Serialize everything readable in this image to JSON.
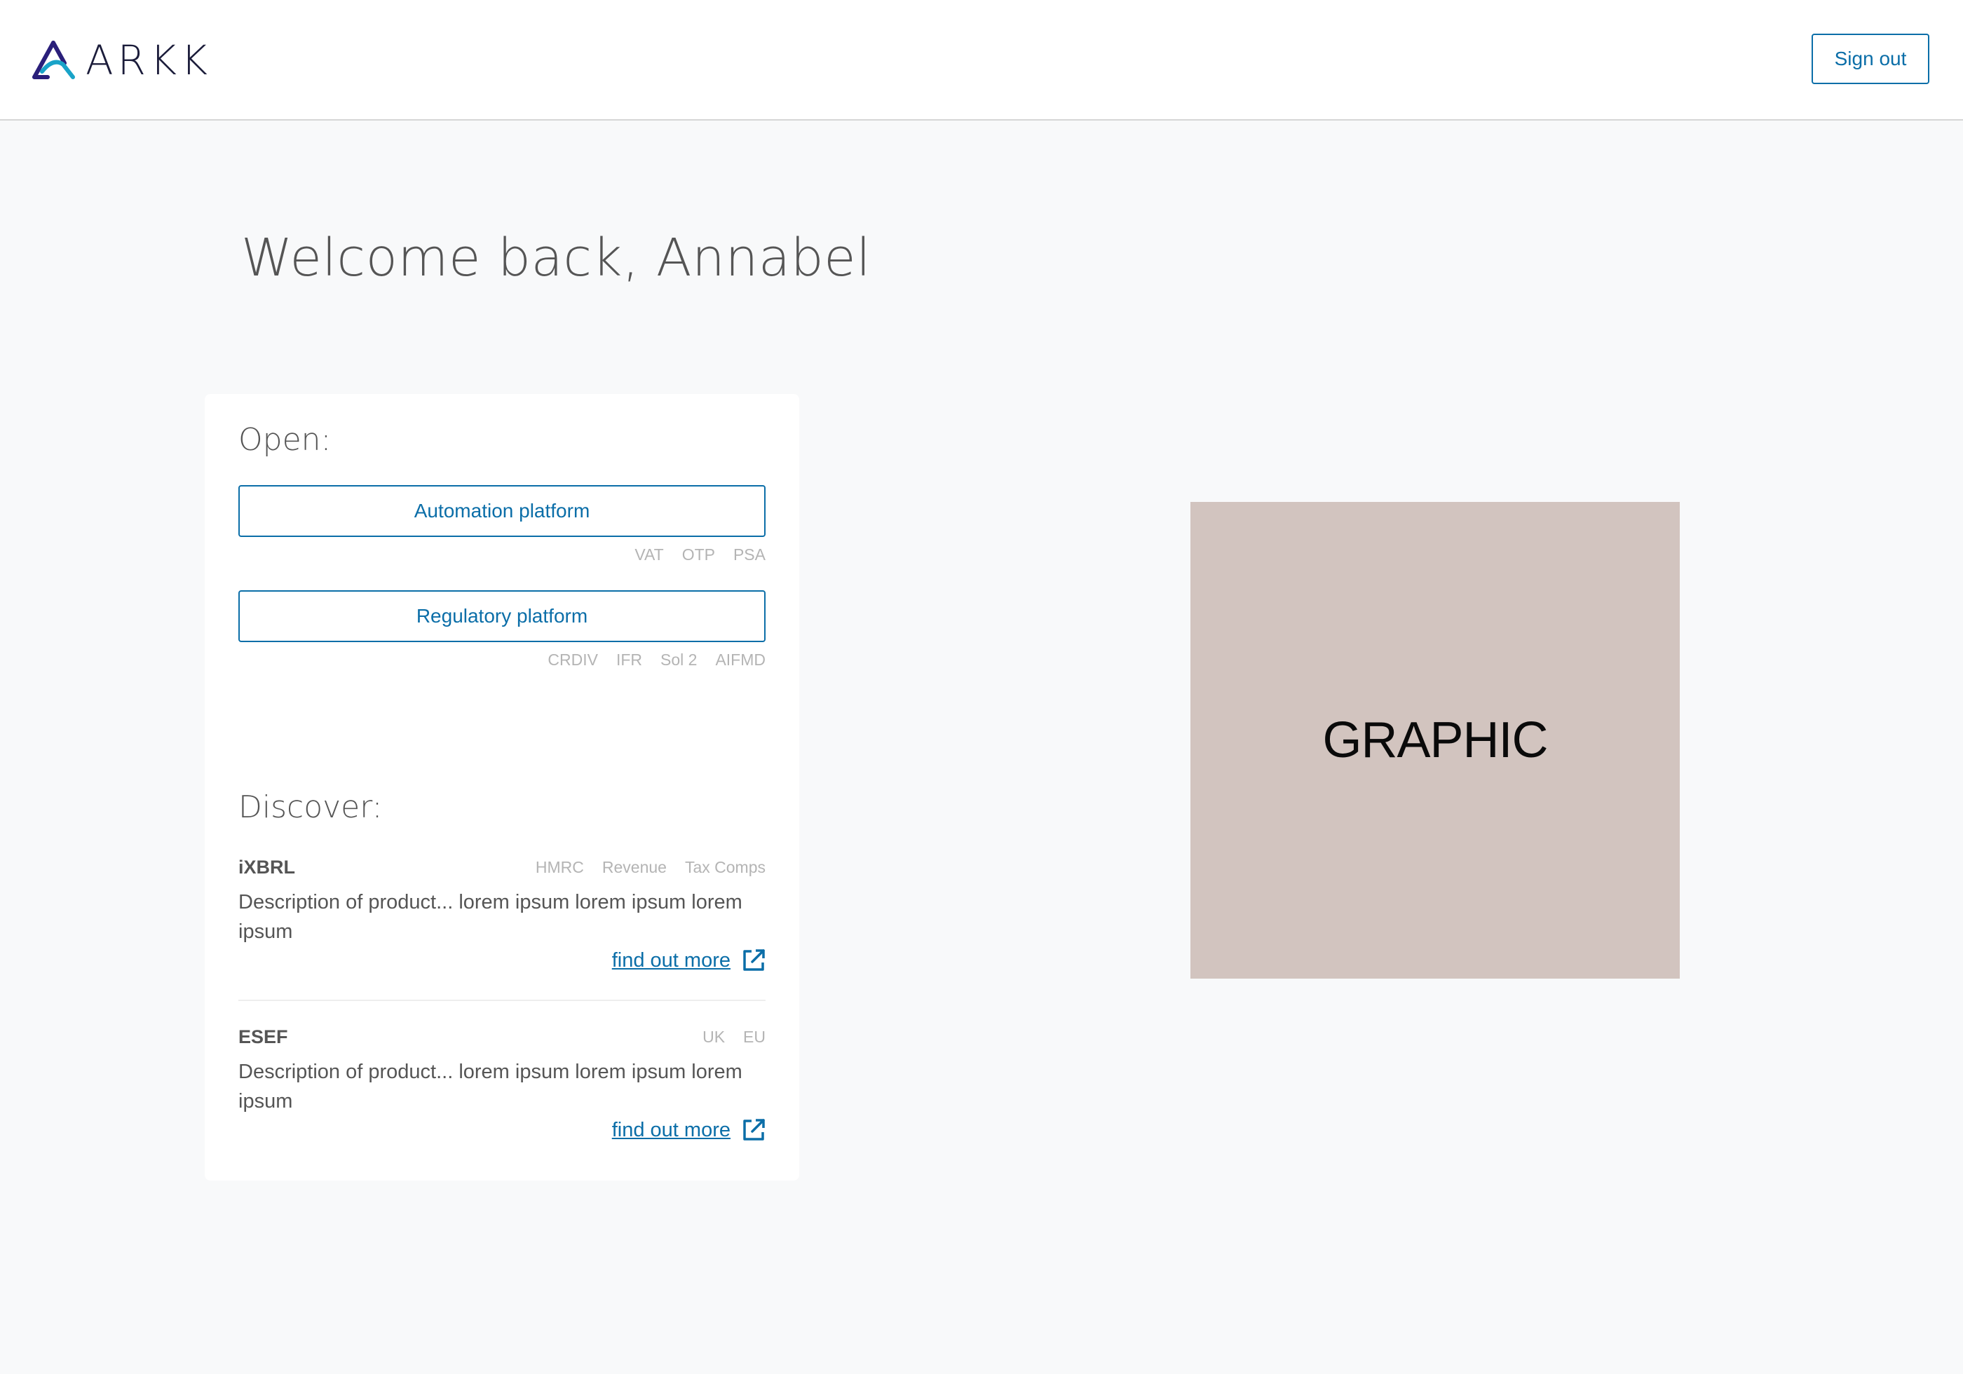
{
  "header": {
    "logo_text": "ARKK",
    "sign_out_label": "Sign out"
  },
  "welcome": {
    "title": "Welcome back, Annabel"
  },
  "open": {
    "heading": "Open:",
    "platforms": [
      {
        "label": "Automation platform",
        "tags": [
          "VAT",
          "OTP",
          "PSA"
        ]
      },
      {
        "label": "Regulatory platform",
        "tags": [
          "CRDIV",
          "IFR",
          "Sol 2",
          "AIFMD"
        ]
      }
    ]
  },
  "discover": {
    "heading": "Discover:",
    "products": [
      {
        "name": "iXBRL",
        "tags": [
          "HMRC",
          "Revenue",
          "Tax Comps"
        ],
        "description": "Description of product... lorem ipsum lorem ipsum lorem ipsum",
        "link_label": "find out more"
      },
      {
        "name": "ESEF",
        "tags": [
          "UK",
          "EU"
        ],
        "description": "Description of product... lorem ipsum lorem ipsum lorem ipsum",
        "link_label": "find out more"
      }
    ]
  },
  "graphic": {
    "label": "GRAPHIC"
  },
  "colors": {
    "brand_blue": "#0b6ea8",
    "page_background": "#f8f9fa",
    "graphic_background": "#d2c4bf",
    "tag_grey": "#b4b4b4"
  },
  "icons": {
    "logo": "arkk-logo-icon",
    "external_link": "external-link-icon"
  }
}
